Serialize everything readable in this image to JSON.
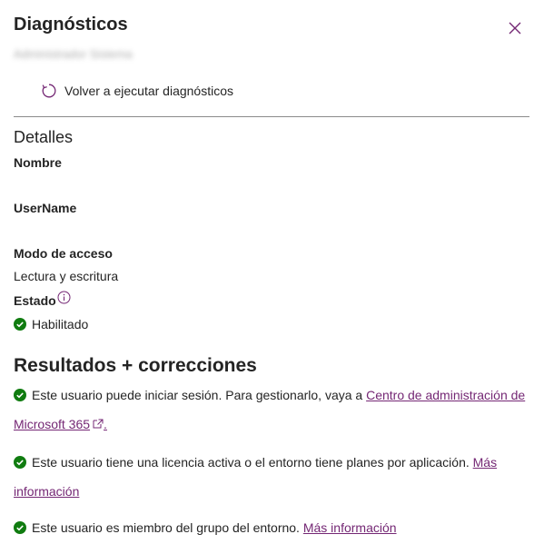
{
  "panel": {
    "title": "Diagnósticos",
    "subtitle_redacted": "Administrador Sistema",
    "rerun_label": "Volver a ejecutar diagnósticos"
  },
  "details": {
    "heading": "Detalles",
    "name_label": "Nombre",
    "name_value": "",
    "username_label": "UserName",
    "username_value": "",
    "access_label": "Modo de acceso",
    "access_value": "Lectura y escritura",
    "state_label": "Estado",
    "state_value": "Habilitado"
  },
  "results": {
    "heading": "Resultados + correcciones",
    "items": [
      {
        "text": "Este usuario puede iniciar sesión. Para gestionarlo, vaya a ",
        "link": "Centro de administración de Microsoft 365",
        "suffix": "."
      },
      {
        "text": "Este usuario tiene una licencia activa o el entorno tiene planes por aplicación. ",
        "link": "Más información",
        "suffix": ""
      },
      {
        "text": "Este usuario es miembro del grupo del entorno. ",
        "link": "Más información",
        "suffix": ""
      }
    ]
  },
  "colors": {
    "success": "#107c10",
    "link": "#742774",
    "accent": "#742774"
  },
  "icons": {
    "close": "close-icon",
    "rerun": "refresh-icon",
    "info": "info-icon",
    "success": "checkmark-circle-icon",
    "external": "open-external-icon"
  }
}
